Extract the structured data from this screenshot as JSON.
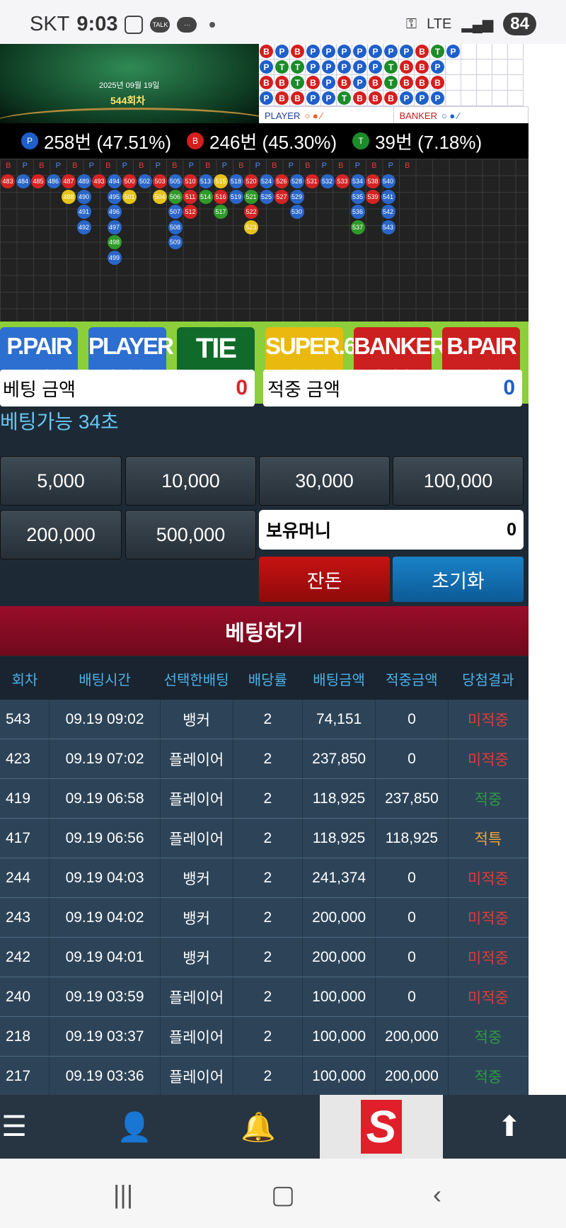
{
  "status": {
    "carrier": "SKT",
    "time": "9:03",
    "talk": "TALK",
    "net": "LTE",
    "battery": "84"
  },
  "table": {
    "date": "2025년 09월 19일",
    "round": "544회차"
  },
  "bead_rows": [
    [
      "B",
      "P",
      "B",
      "P",
      "P",
      "P",
      "P",
      "P",
      "P",
      "P",
      "B",
      "T",
      "P"
    ],
    [
      "P",
      "T",
      "T",
      "P",
      "P",
      "P",
      "P",
      "P",
      "T",
      "B",
      "B",
      "P"
    ],
    [
      "B",
      "B",
      "T",
      "B",
      "P",
      "B",
      "P",
      "B",
      "T",
      "B",
      "B",
      "B"
    ],
    [
      "P",
      "B",
      "B",
      "P",
      "P",
      "T",
      "B",
      "B",
      "B",
      "P",
      "P",
      "P"
    ]
  ],
  "bead_legend": {
    "player": "PLAYER",
    "banker": "BANKER"
  },
  "stats": {
    "player": {
      "badge": "P",
      "text": "258번 (47.51%)"
    },
    "banker": {
      "badge": "B",
      "text": "246번 (45.30%)"
    },
    "tie": {
      "badge": "T",
      "text": "39번 (7.18%)"
    }
  },
  "road_header": [
    "B",
    "P",
    "B",
    "P",
    "B",
    "P",
    "B",
    "P",
    "B",
    "P",
    "B",
    "P",
    "B",
    "P",
    "B",
    "P",
    "B",
    "P",
    "B",
    "P",
    "B",
    "P",
    "B",
    "P",
    "B"
  ],
  "road_columns": [
    {
      "c": 0,
      "items": [
        [
          "483",
          "B"
        ]
      ]
    },
    {
      "c": 1,
      "items": [
        [
          "484",
          "P"
        ]
      ]
    },
    {
      "c": 2,
      "items": [
        [
          "485",
          "B"
        ]
      ]
    },
    {
      "c": 3,
      "items": [
        [
          "486",
          "P"
        ]
      ]
    },
    {
      "c": 4,
      "items": [
        [
          "487",
          "B"
        ],
        [
          "488",
          "Y"
        ]
      ]
    },
    {
      "c": 5,
      "items": [
        [
          "489",
          "P"
        ],
        [
          "490",
          "P"
        ],
        [
          "491",
          "P"
        ],
        [
          "492",
          "P"
        ]
      ]
    },
    {
      "c": 6,
      "items": [
        [
          "493",
          "B"
        ]
      ]
    },
    {
      "c": 7,
      "items": [
        [
          "494",
          "P"
        ],
        [
          "495",
          "P"
        ],
        [
          "496",
          "P"
        ],
        [
          "497",
          "P"
        ],
        [
          "498",
          "T"
        ],
        [
          "499",
          "P"
        ]
      ]
    },
    {
      "c": 8,
      "items": [
        [
          "500",
          "B"
        ],
        [
          "501",
          "Y"
        ]
      ]
    },
    {
      "c": 9,
      "items": [
        [
          "502",
          "P"
        ]
      ]
    },
    {
      "c": 10,
      "items": [
        [
          "503",
          "B"
        ],
        [
          "504",
          "Y"
        ]
      ]
    },
    {
      "c": 11,
      "items": [
        [
          "505",
          "P"
        ],
        [
          "506",
          "T"
        ],
        [
          "507",
          "P"
        ],
        [
          "508",
          "P"
        ],
        [
          "509",
          "P"
        ]
      ]
    },
    {
      "c": 12,
      "items": [
        [
          "510",
          "B"
        ],
        [
          "511",
          "B"
        ],
        [
          "512",
          "B"
        ]
      ]
    },
    {
      "c": 13,
      "items": [
        [
          "513",
          "P"
        ],
        [
          "514",
          "T"
        ]
      ]
    },
    {
      "c": 14,
      "items": [
        [
          "515",
          "Y"
        ],
        [
          "516",
          "B"
        ],
        [
          "517",
          "T"
        ]
      ]
    },
    {
      "c": 15,
      "items": [
        [
          "518",
          "P"
        ],
        [
          "519",
          "P"
        ]
      ]
    },
    {
      "c": 16,
      "items": [
        [
          "520",
          "B"
        ],
        [
          "521",
          "T"
        ],
        [
          "522",
          "B"
        ],
        [
          "523",
          "Y"
        ]
      ]
    },
    {
      "c": 17,
      "items": [
        [
          "524",
          "P"
        ],
        [
          "525",
          "P"
        ]
      ]
    },
    {
      "c": 18,
      "items": [
        [
          "526",
          "B"
        ],
        [
          "527",
          "B"
        ]
      ]
    },
    {
      "c": 19,
      "items": [
        [
          "528",
          "P"
        ],
        [
          "529",
          "P"
        ],
        [
          "530",
          "P"
        ]
      ]
    },
    {
      "c": 20,
      "items": [
        [
          "531",
          "B"
        ]
      ]
    },
    {
      "c": 21,
      "items": [
        [
          "532",
          "P"
        ]
      ]
    },
    {
      "c": 22,
      "items": [
        [
          "533",
          "B"
        ]
      ]
    },
    {
      "c": 23,
      "items": [
        [
          "534",
          "P"
        ],
        [
          "535",
          "P"
        ],
        [
          "536",
          "P"
        ],
        [
          "537",
          "T"
        ]
      ]
    },
    {
      "c": 24,
      "items": [
        [
          "538",
          "B"
        ],
        [
          "539",
          "B"
        ]
      ]
    },
    {
      "c": 25,
      "items": [
        [
          "540",
          "P"
        ],
        [
          "541",
          "P"
        ],
        [
          "542",
          "P"
        ],
        [
          "543",
          "P"
        ]
      ]
    }
  ],
  "odds": [
    {
      "name": "P.PAIR",
      "value": "11.00",
      "color": "#2d6fd0"
    },
    {
      "name": "PLAYER",
      "value": "2.00",
      "color": "#2d6fd0"
    },
    {
      "name": "TIE",
      "value": "8.00",
      "color": "#106b2a"
    },
    {
      "name": "SUPER.6",
      "value": "12.00",
      "color": "#e9b90f"
    },
    {
      "name": "BANKER",
      "value": "2.00",
      "color": "#cc1f1f"
    },
    {
      "name": "B.PAIR",
      "value": "11.00",
      "color": "#cc1f1f"
    }
  ],
  "timer": "베팅가능 34초",
  "bet_amount": {
    "label": "베팅 금액",
    "value": "0"
  },
  "win_amount": {
    "label": "적중 금액",
    "value": "0"
  },
  "chips": [
    "5,000",
    "10,000",
    "30,000",
    "100,000",
    "200,000",
    "500,000"
  ],
  "holding": {
    "label": "보유머니",
    "value": "0"
  },
  "buttons": {
    "allin": "잔돈",
    "reset": "초기화"
  },
  "bet_button": "베팅하기",
  "history_headers": [
    "회차",
    "배팅시간",
    "선택한배팅",
    "배당률",
    "배팅금액",
    "적중금액",
    "당첨결과"
  ],
  "history": [
    {
      "round": "543",
      "time": "09.19 09:02",
      "pick": "뱅커",
      "odds": "2",
      "amount": "74,151",
      "win": "0",
      "result": "미적중",
      "rtype": "miss"
    },
    {
      "round": "423",
      "time": "09.19 07:02",
      "pick": "플레이어",
      "odds": "2",
      "amount": "237,850",
      "win": "0",
      "result": "미적중",
      "rtype": "miss"
    },
    {
      "round": "419",
      "time": "09.19 06:58",
      "pick": "플레이어",
      "odds": "2",
      "amount": "118,925",
      "win": "237,850",
      "result": "적중",
      "rtype": "hit"
    },
    {
      "round": "417",
      "time": "09.19 06:56",
      "pick": "플레이어",
      "odds": "2",
      "amount": "118,925",
      "win": "118,925",
      "result": "적특",
      "rtype": "special"
    },
    {
      "round": "244",
      "time": "09.19 04:03",
      "pick": "뱅커",
      "odds": "2",
      "amount": "241,374",
      "win": "0",
      "result": "미적중",
      "rtype": "miss"
    },
    {
      "round": "243",
      "time": "09.19 04:02",
      "pick": "뱅커",
      "odds": "2",
      "amount": "200,000",
      "win": "0",
      "result": "미적중",
      "rtype": "miss"
    },
    {
      "round": "242",
      "time": "09.19 04:01",
      "pick": "뱅커",
      "odds": "2",
      "amount": "200,000",
      "win": "0",
      "result": "미적중",
      "rtype": "miss"
    },
    {
      "round": "240",
      "time": "09.19 03:59",
      "pick": "플레이어",
      "odds": "2",
      "amount": "100,000",
      "win": "0",
      "result": "미적중",
      "rtype": "miss"
    },
    {
      "round": "218",
      "time": "09.19 03:37",
      "pick": "플레이어",
      "odds": "2",
      "amount": "100,000",
      "win": "200,000",
      "result": "적중",
      "rtype": "hit"
    },
    {
      "round": "217",
      "time": "09.19 03:36",
      "pick": "플레이어",
      "odds": "2",
      "amount": "100,000",
      "win": "200,000",
      "result": "적중",
      "rtype": "hit"
    }
  ],
  "nav": {
    "logo": "S",
    "icons": [
      "menu-icon",
      "user-icon",
      "bell-icon",
      "logo",
      "arrow-up-icon"
    ]
  }
}
